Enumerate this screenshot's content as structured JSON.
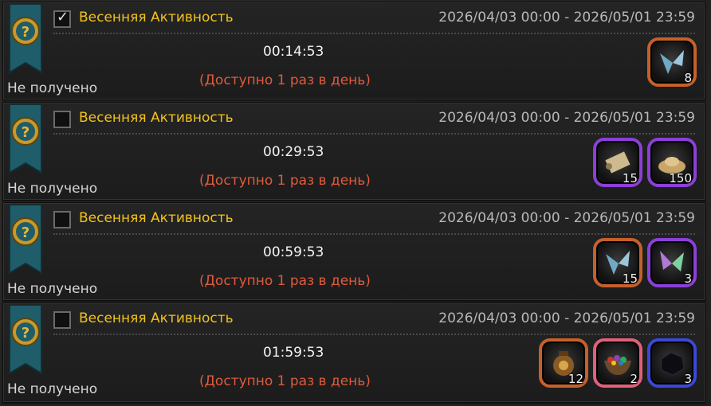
{
  "rows": [
    {
      "checked": true,
      "title": "Весенняя Активность",
      "date_range": "2026/04/03 00:00 - 2026/05/01 23:59",
      "timer": "00:14:53",
      "availability": "(Доступно 1 раз в день)",
      "status": "Не получено",
      "rewards": [
        {
          "icon": "wings-icon",
          "count": "8",
          "frame": "orange"
        }
      ]
    },
    {
      "checked": false,
      "title": "Весенняя Активность",
      "date_range": "2026/04/03 00:00 - 2026/05/01 23:59",
      "timer": "00:29:53",
      "availability": "(Доступно 1 раз в день)",
      "status": "Не получено",
      "rewards": [
        {
          "icon": "scroll-icon",
          "count": "15",
          "frame": "purple"
        },
        {
          "icon": "gold-ingot-icon",
          "count": "150",
          "frame": "purple"
        }
      ]
    },
    {
      "checked": false,
      "title": "Весенняя Активность",
      "date_range": "2026/04/03 00:00 - 2026/05/01 23:59",
      "timer": "00:59:53",
      "availability": "(Доступно 1 раз в день)",
      "status": "Не получено",
      "rewards": [
        {
          "icon": "wings-icon",
          "count": "15",
          "frame": "orange"
        },
        {
          "icon": "butterfly-wings-icon",
          "count": "3",
          "frame": "purple"
        }
      ]
    },
    {
      "checked": false,
      "title": "Весенняя Активность",
      "date_range": "2026/04/03 00:00 - 2026/05/01 23:59",
      "timer": "01:59:53",
      "availability": "(Доступно 1 раз в день)",
      "status": "Не получено",
      "rewards": [
        {
          "icon": "pouch-icon",
          "count": "12",
          "frame": "orange"
        },
        {
          "icon": "gem-bowl-icon",
          "count": "2",
          "frame": "pink"
        },
        {
          "icon": "dark-stone-icon",
          "count": "3",
          "frame": "blue"
        }
      ]
    }
  ]
}
